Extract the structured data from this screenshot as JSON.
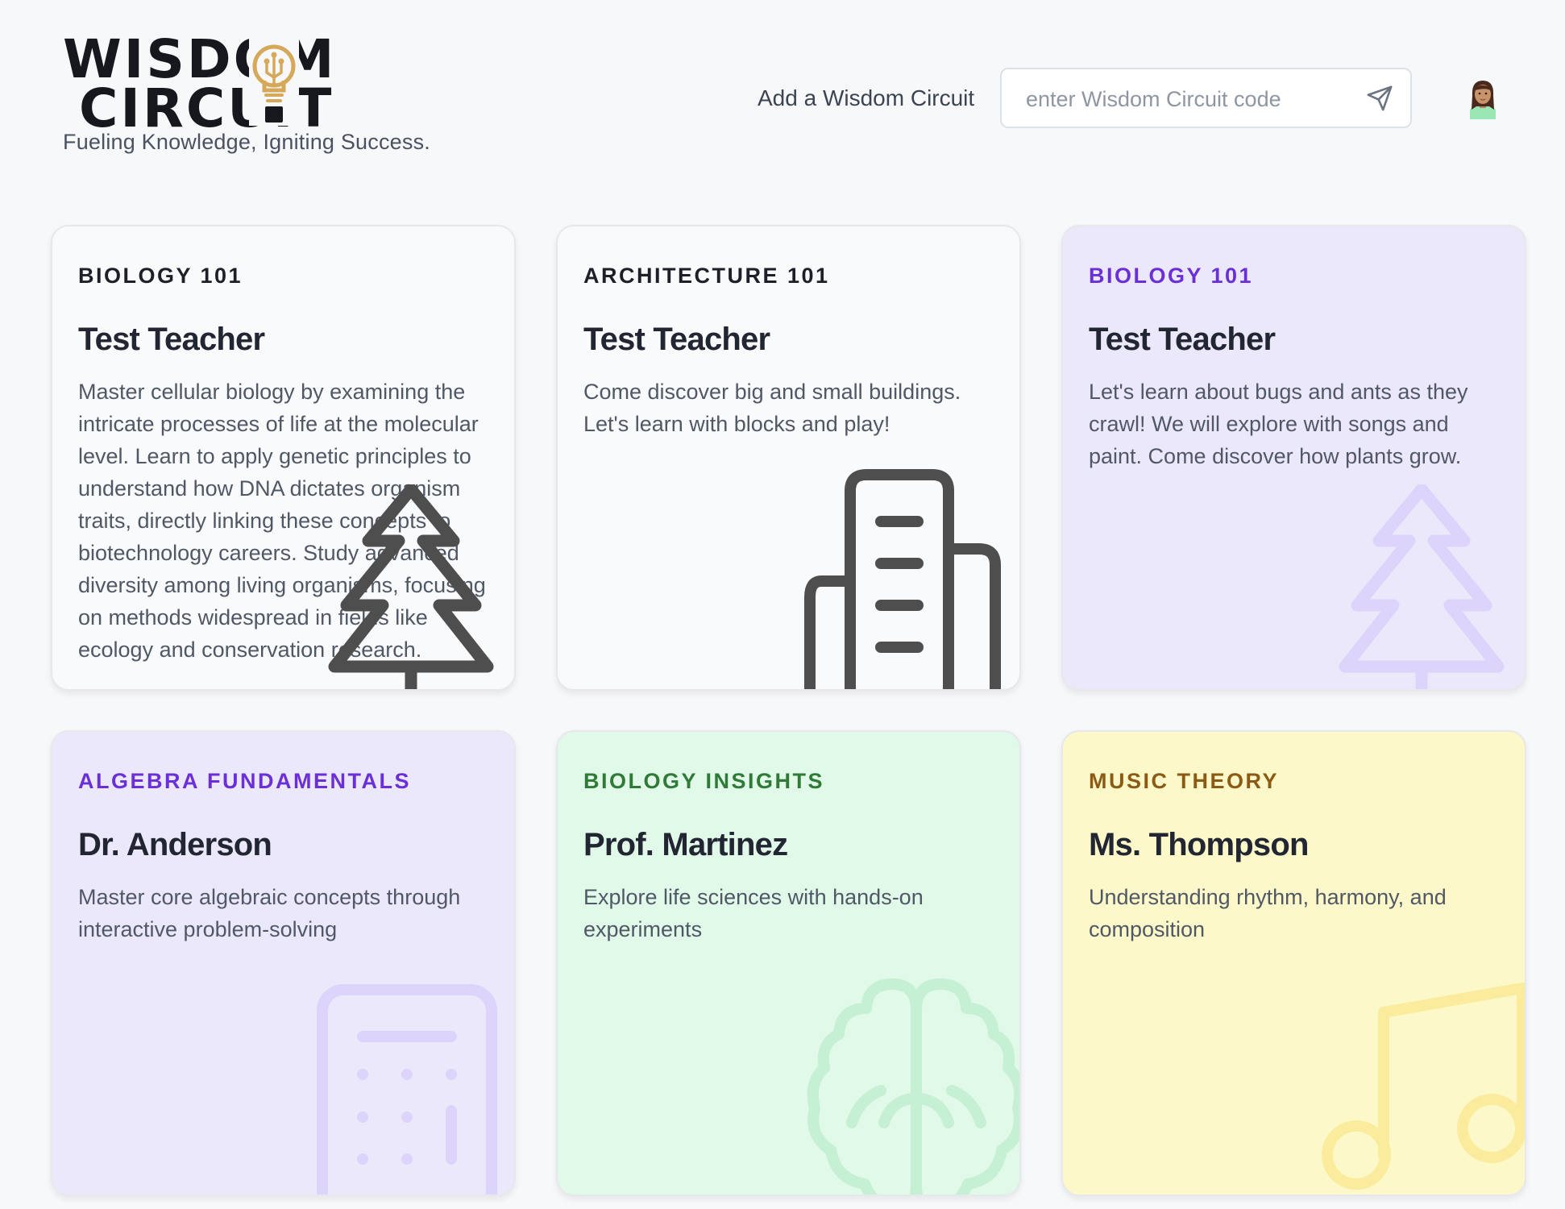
{
  "brand": {
    "logo_line1": "WISDOM",
    "logo_line2": "CIRCUIT",
    "tagline": "Fueling Knowledge, Igniting Success."
  },
  "header": {
    "add_label": "Add a Wisdom Circuit",
    "code_placeholder": "enter Wisdom Circuit code",
    "code_value": "",
    "send_icon": "send-icon",
    "avatar_icon": "woman-avatar"
  },
  "colors": {
    "page_bg": "#f7f8fa",
    "purple_card": "#ece8fb",
    "green_card": "#e1f9e8",
    "yellow_card": "#fdf8c9",
    "logo_gold": "#d6a85a"
  },
  "cards": [
    {
      "course": "BIOLOGY 101",
      "teacher": "Test Teacher",
      "description": "Master cellular biology by examining the intricate processes of life at the molecular level. Learn to apply genetic principles to understand how DNA dictates organism traits, directly linking these concepts to biotechnology careers. Study advanced diversity among living organisms, focusing on methods widespread in fields like ecology and conservation research.",
      "theme": "white",
      "icon": "tree-icon"
    },
    {
      "course": "ARCHITECTURE 101",
      "teacher": "Test Teacher",
      "description": "Come discover big and small buildings. Let's learn with blocks and play!",
      "theme": "white",
      "icon": "building-icon"
    },
    {
      "course": "BIOLOGY 101",
      "teacher": "Test Teacher",
      "description": "Let's learn about bugs and ants as they crawl! We will explore with songs and paint. Come discover how plants grow.",
      "theme": "purple",
      "icon": "tree-icon"
    },
    {
      "course": "ALGEBRA FUNDAMENTALS",
      "teacher": "Dr. Anderson",
      "description": "Master core algebraic concepts through interactive problem-solving",
      "theme": "purple",
      "icon": "calculator-icon"
    },
    {
      "course": "BIOLOGY INSIGHTS",
      "teacher": "Prof. Martinez",
      "description": "Explore life sciences with hands-on experiments",
      "theme": "green",
      "icon": "brain-icon"
    },
    {
      "course": "MUSIC THEORY",
      "teacher": "Ms. Thompson",
      "description": "Understanding rhythm, harmony, and composition",
      "theme": "yellow",
      "icon": "music-note-icon"
    }
  ]
}
